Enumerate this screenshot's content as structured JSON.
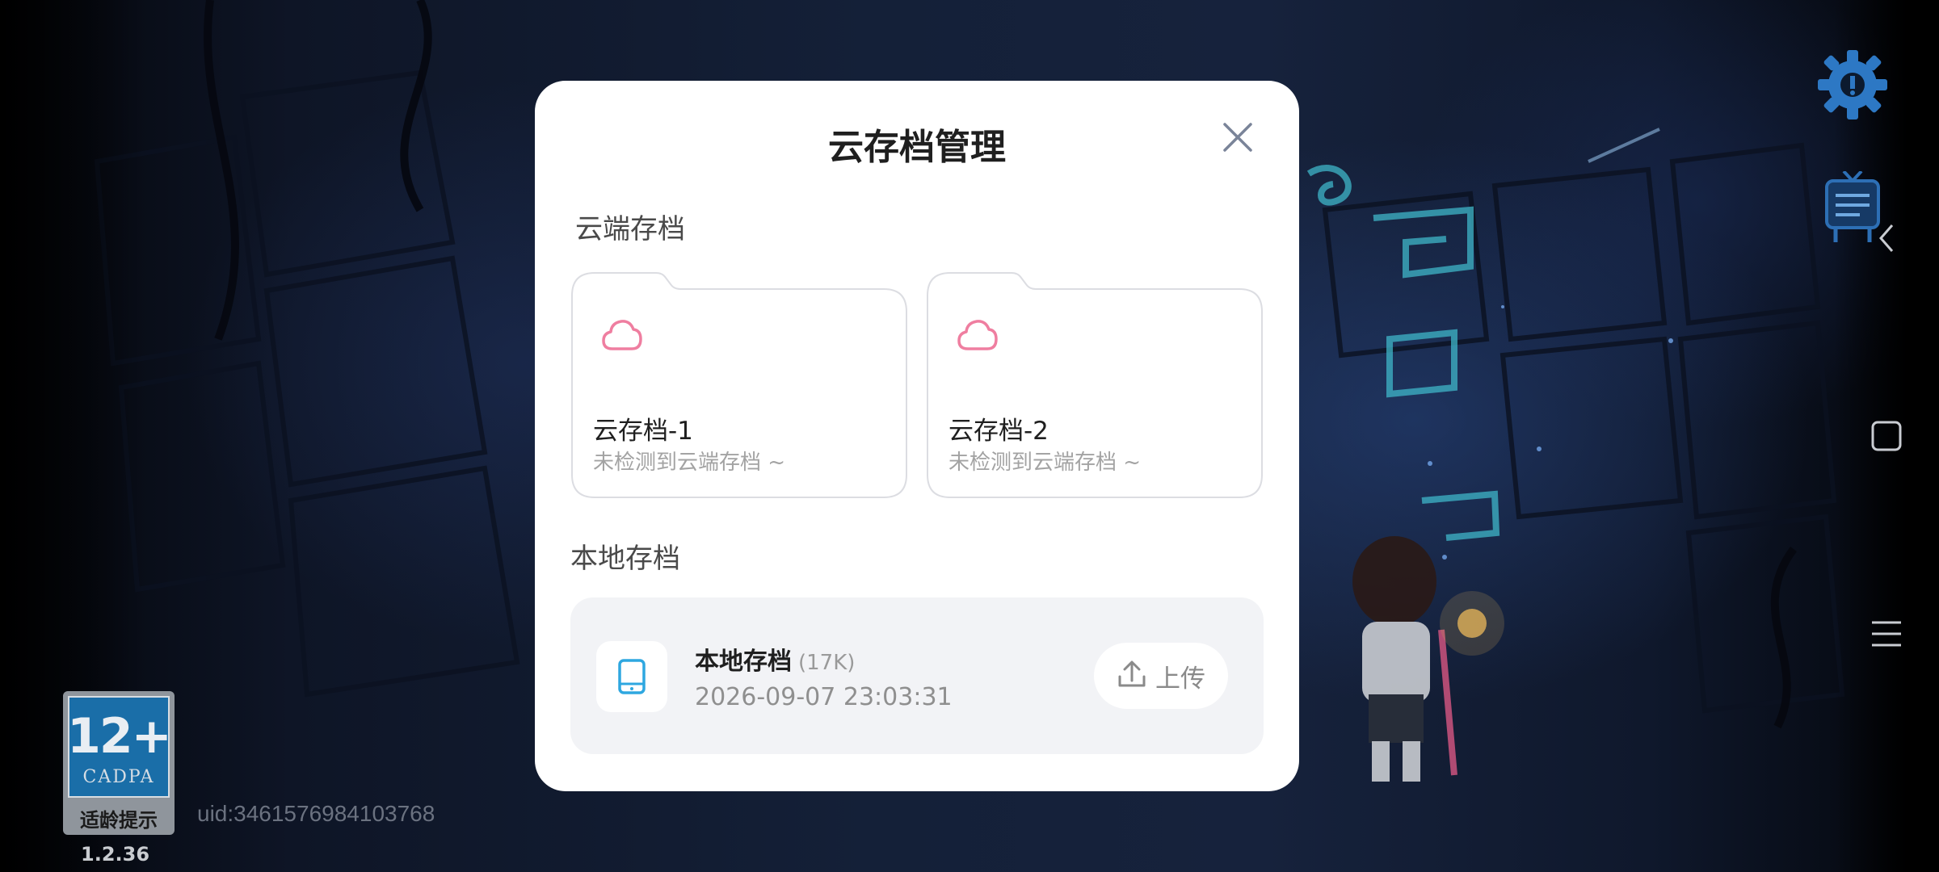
{
  "modal": {
    "title": "云存档管理",
    "cloud_section_title": "云端存档",
    "cloud_slots": [
      {
        "name": "云存档-1",
        "status": "未检测到云端存档 ~"
      },
      {
        "name": "云存档-2",
        "status": "未检测到云端存档 ~"
      }
    ],
    "local_section_title": "本地存档",
    "local_save": {
      "name": "本地存档",
      "size": "(17K)",
      "timestamp": "2026-09-07 23:03:31",
      "upload_label": "上传"
    }
  },
  "overlay": {
    "uid": "uid:3461576984103768",
    "age_rating": "12+",
    "rating_org": "CADPA",
    "age_tip": "适龄提示",
    "version": "1.2.36"
  },
  "icons": {
    "settings": "gear-icon",
    "notice": "notice-board-icon",
    "close": "close-icon",
    "cloud": "cloud-icon",
    "device": "phone-icon",
    "upload": "upload-icon",
    "nav_back": "back-chevron-icon",
    "nav_home": "home-square-icon",
    "nav_recent": "menu-lines-icon"
  },
  "colors": {
    "cloud_icon": "#ef7ea0",
    "device_icon": "#2ea7e0",
    "modal_bg": "#ffffff",
    "local_card_bg": "#f2f3f6"
  }
}
